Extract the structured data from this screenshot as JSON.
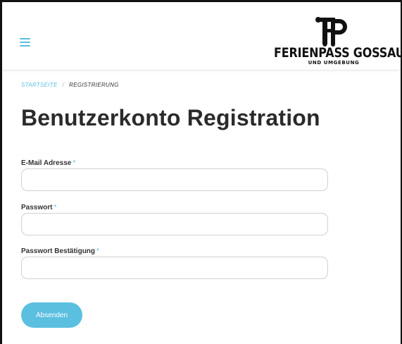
{
  "header": {
    "menu_icon": "hamburger-icon",
    "logo": {
      "main_text": "FERIENPASS GOSSAU",
      "sub_text": "UND UMGEBUNG",
      "mark_icon": "fp-monogram-icon"
    }
  },
  "breadcrumb": {
    "home": "STARTSEITE",
    "separator": "/",
    "current": "REGISTRIERUNG"
  },
  "page": {
    "title": "Benutzerkonto Registration"
  },
  "form": {
    "required_marker": "*",
    "fields": [
      {
        "label": "E-Mail Adresse",
        "value": "",
        "placeholder": ""
      },
      {
        "label": "Passwort",
        "value": "",
        "placeholder": ""
      },
      {
        "label": "Passwort Bestätigung",
        "value": "",
        "placeholder": ""
      }
    ],
    "submit_label": "Absenden"
  },
  "colors": {
    "accent": "#5bbfe0",
    "title": "#2b2b2b",
    "input_border": "#d0d0d0"
  }
}
